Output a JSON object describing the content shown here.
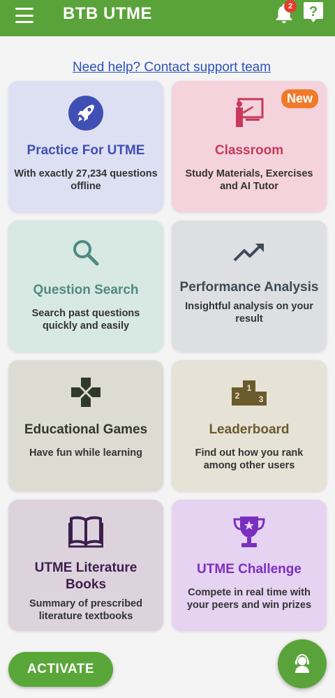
{
  "appbar": {
    "title": "BTB UTME",
    "notification_count": "2",
    "background": "#5aa33a"
  },
  "support_link": "Need help? Contact support team",
  "cards": [
    {
      "title": "Practice For UTME",
      "desc": "With exactly 27,234 questions offline",
      "icon": "rocket-icon",
      "bg": "#dde0f2",
      "title_color": "#3f4fb3"
    },
    {
      "title": "Classroom",
      "desc": "Study Materials, Exercises and AI Tutor",
      "icon": "classroom-icon",
      "badge": "New",
      "bg": "#f4d3dc",
      "title_color": "#c73a5c"
    },
    {
      "title": "Question Search",
      "desc": "Search past questions quickly and easily",
      "icon": "search-icon",
      "bg": "#d8e8e2",
      "title_color": "#4f8a83"
    },
    {
      "title": "Performance Analysis",
      "desc": "Insightful analysis on your result",
      "icon": "trending-up-icon",
      "bg": "#dddfe3",
      "title_color": "#3e4a57"
    },
    {
      "title": "Educational Games",
      "desc": "Have fun while learning",
      "icon": "gamepad-icon",
      "bg": "#dcdcd3",
      "title_color": "#2f3a2a"
    },
    {
      "title": "Leaderboard",
      "desc": "Find out how you rank among other users",
      "icon": "podium-icon",
      "bg": "#e6e2d6",
      "title_color": "#6b5a2c"
    },
    {
      "title": "UTME Literature Books",
      "desc": "Summary of prescribed literature textbooks",
      "icon": "book-icon",
      "bg": "#ddd3dd",
      "title_color": "#3b1f4d"
    },
    {
      "title": "UTME Challenge",
      "desc": "Compete in real time with your peers and win prizes",
      "icon": "trophy-icon",
      "bg": "#e6d3f2",
      "title_color": "#7a2fbf"
    }
  ],
  "activate_label": "ACTIVATE",
  "fab_icon": "support-agent-icon"
}
